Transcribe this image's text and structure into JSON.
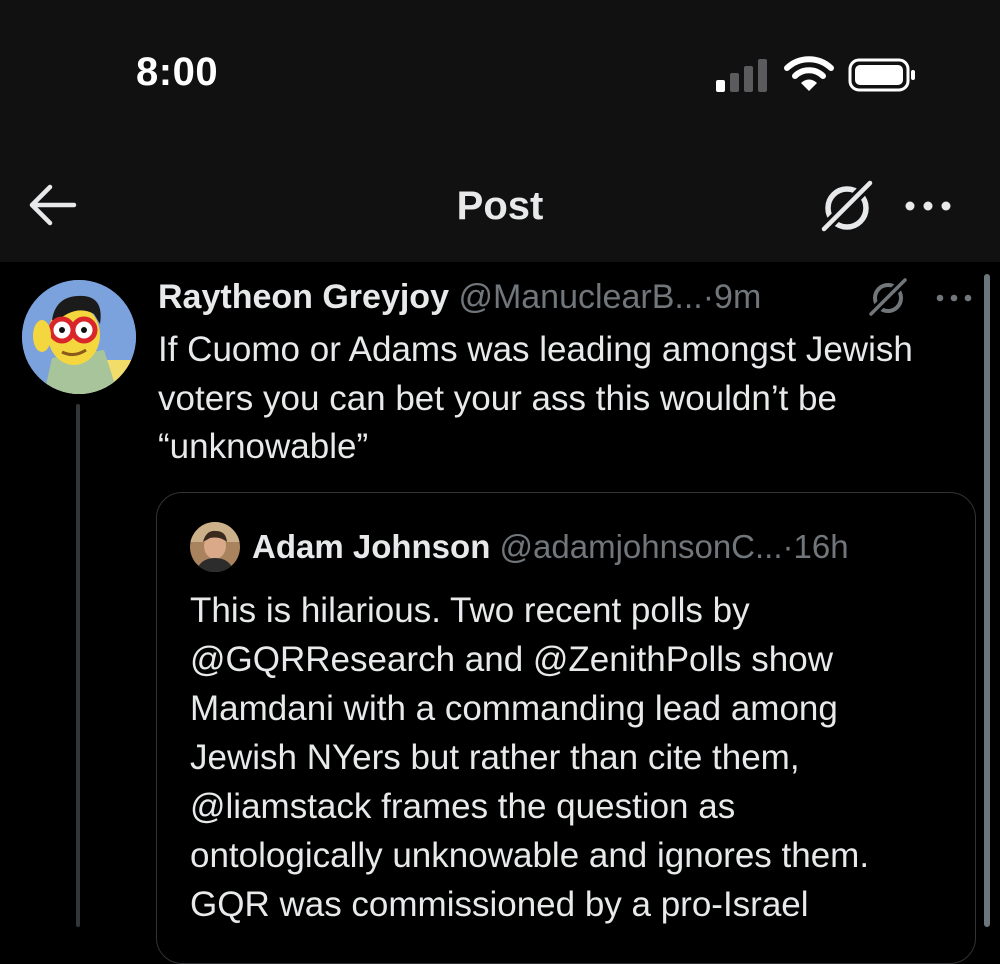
{
  "status_bar": {
    "time": "8:00",
    "signal_bars_active": 1,
    "signal_bars_total": 4,
    "icons": [
      "cellular-signal-icon",
      "wifi-icon",
      "battery-icon"
    ]
  },
  "nav": {
    "title": "Post",
    "icons": [
      "back-arrow-icon",
      "grok-icon",
      "more-options-icon"
    ]
  },
  "post": {
    "author_name": "Raytheon Greyjoy",
    "author_handle": "@ManuclearB...",
    "separator": "·",
    "time": "9m",
    "text_lines": [
      "If Cuomo or Adams was leading amongst Jewish",
      "voters you can bet your ass this wouldn’t be",
      "“unknowable”"
    ]
  },
  "quoted_post": {
    "author_name": "Adam Johnson",
    "author_handle": "@adamjohnsonC...",
    "separator": "·",
    "time": "16h",
    "text_lines": [
      "This is hilarious. Two recent polls by",
      "@GQRResearch and @ZenithPolls show",
      "Mamdani with a commanding lead among",
      "Jewish NYers but rather than cite them,",
      "@liamstack frames the question as",
      "ontologically unknowable and ignores them.",
      "GQR was commissioned by a pro-Israel"
    ]
  },
  "colors": {
    "background": "#000000",
    "status_bar_bg": "#111111",
    "text_primary": "#e7e9ea",
    "text_secondary": "#71767b",
    "border": "#2f3336"
  }
}
